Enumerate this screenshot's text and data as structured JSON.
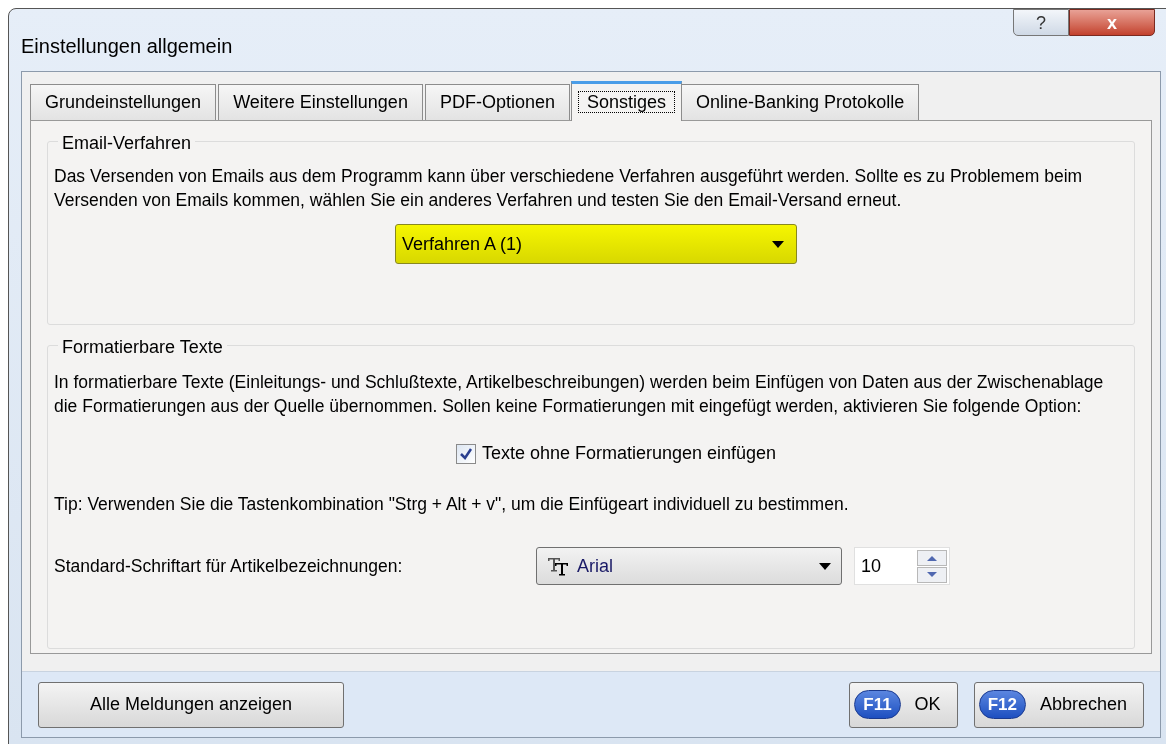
{
  "window": {
    "title": "Einstellungen allgemein",
    "help_button": "?",
    "close_button": "x"
  },
  "tabs": [
    {
      "label": "Grundeinstellungen",
      "selected": false
    },
    {
      "label": "Weitere Einstellungen",
      "selected": false
    },
    {
      "label": "PDF-Optionen",
      "selected": false
    },
    {
      "label": "Sonstiges",
      "selected": true
    },
    {
      "label": "Online-Banking Protokolle",
      "selected": false
    }
  ],
  "email_group": {
    "title": "Email-Verfahren",
    "description": "Das Versenden von Emails aus dem Programm kann über verschiedene Verfahren ausgeführt werden. Sollte es zu Problemem beim Versenden von Emails kommen, wählen Sie ein anderes Verfahren und testen Sie den Email-Versand erneut.",
    "method_dropdown": {
      "value": "Verfahren A (1)"
    }
  },
  "format_group": {
    "title": "Formatierbare Texte",
    "description": "In formatierbare Texte (Einleitungs- und Schlußtexte, Artikelbeschreibungen) werden beim Einfügen von Daten aus der Zwischenablage die Formatierungen aus der Quelle übernommen. Sollen keine Formatierungen mit eingefügt werden, aktivieren Sie folgende Option:",
    "checkbox": {
      "label": "Texte ohne Formatierungen einfügen",
      "checked": true
    },
    "tip": "Tip: Verwenden Sie die Tastenkombination \"Strg + Alt + v\", um die Einfügeart individuell zu bestimmen.",
    "font_label": "Standard-Schriftart für Artikelbezeichnungen:",
    "font_dropdown": {
      "value": "Arial"
    },
    "size_spinner": {
      "value": "10"
    }
  },
  "footer": {
    "left_button": "Alle Meldungen anzeigen",
    "buttons": [
      {
        "key": "F11",
        "label": "OK"
      },
      {
        "key": "F12",
        "label": "Abbrechen"
      }
    ]
  }
}
